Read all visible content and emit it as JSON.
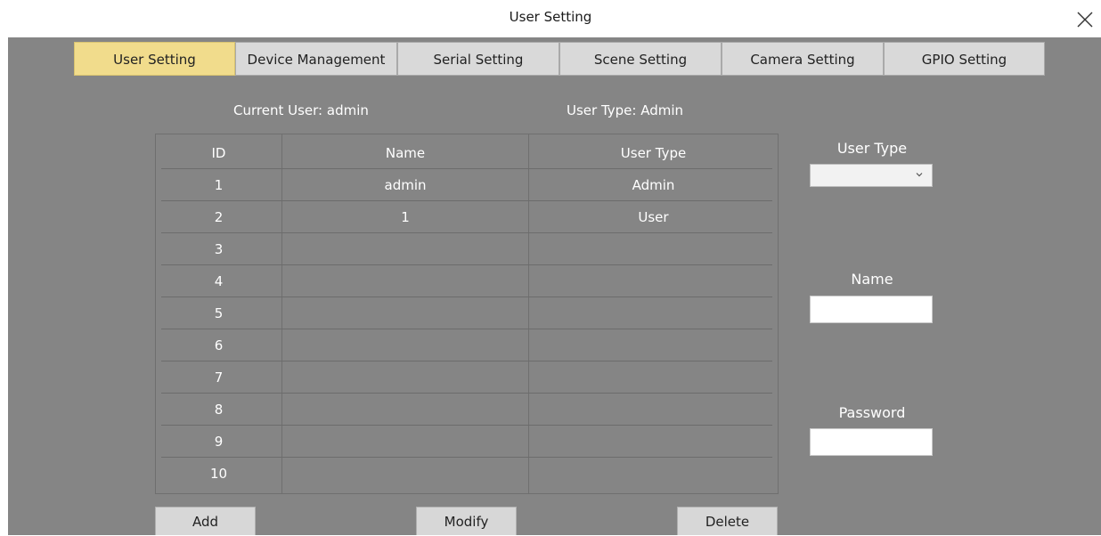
{
  "window": {
    "title": "User Setting",
    "close_icon": "close-icon"
  },
  "tabs": [
    {
      "label": "User Setting",
      "active": true
    },
    {
      "label": "Device Management",
      "active": false
    },
    {
      "label": "Serial Setting",
      "active": false
    },
    {
      "label": "Scene Setting",
      "active": false
    },
    {
      "label": "Camera Setting",
      "active": false
    },
    {
      "label": "GPIO Setting",
      "active": false
    }
  ],
  "info": {
    "current_user_label": "Current User:",
    "current_user_value": "admin",
    "user_type_label": "User Type:",
    "user_type_value": "Admin"
  },
  "table": {
    "headers": [
      "ID",
      "Name",
      "User Type"
    ],
    "rows": [
      {
        "id": "1",
        "name": "admin",
        "type": "Admin"
      },
      {
        "id": "2",
        "name": "1",
        "type": "User"
      },
      {
        "id": "3",
        "name": "",
        "type": ""
      },
      {
        "id": "4",
        "name": "",
        "type": ""
      },
      {
        "id": "5",
        "name": "",
        "type": ""
      },
      {
        "id": "6",
        "name": "",
        "type": ""
      },
      {
        "id": "7",
        "name": "",
        "type": ""
      },
      {
        "id": "8",
        "name": "",
        "type": ""
      },
      {
        "id": "9",
        "name": "",
        "type": ""
      },
      {
        "id": "10",
        "name": "",
        "type": ""
      }
    ]
  },
  "form": {
    "user_type_label": "User Type",
    "user_type_value": "",
    "name_label": "Name",
    "name_value": "",
    "password_label": "Password",
    "password_value": ""
  },
  "buttons": {
    "add": "Add",
    "modify": "Modify",
    "delete": "Delete"
  },
  "colors": {
    "panel_bg": "#858585",
    "active_tab": "#f1dc8c",
    "tab_bg": "#d9d9d9",
    "button_bg": "#d7d7d7",
    "text_light": "#ffffff"
  }
}
